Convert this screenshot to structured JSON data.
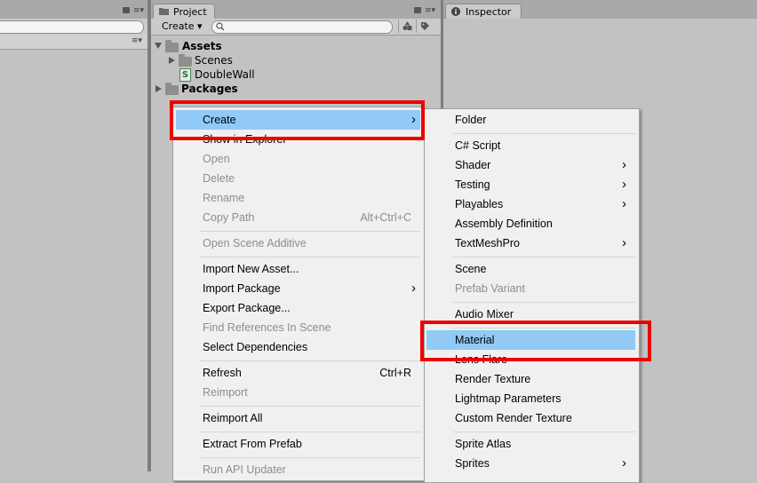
{
  "project_tab": {
    "label": "Project"
  },
  "inspector_tab": {
    "label": "Inspector"
  },
  "project_toolbar": {
    "create_label": "Create ▾"
  },
  "tree": {
    "assets": "Assets",
    "scenes": "Scenes",
    "doublewall": "DoubleWall",
    "packages": "Packages",
    "script_glyph": "S"
  },
  "context_menu": {
    "items": [
      {
        "label": "Create",
        "submenu": true,
        "highlighted": true
      },
      {
        "label": "Show in Explorer"
      },
      {
        "label": "Open",
        "disabled": true
      },
      {
        "label": "Delete",
        "disabled": true
      },
      {
        "label": "Rename",
        "disabled": true
      },
      {
        "label": "Copy Path",
        "shortcut": "Alt+Ctrl+C",
        "disabled": true
      },
      {
        "label": "Open Scene Additive",
        "disabled": true
      },
      {
        "label": "Import New Asset..."
      },
      {
        "label": "Import Package",
        "submenu": true
      },
      {
        "label": "Export Package..."
      },
      {
        "label": "Find References In Scene",
        "disabled": true
      },
      {
        "label": "Select Dependencies"
      },
      {
        "label": "Refresh",
        "shortcut": "Ctrl+R"
      },
      {
        "label": "Reimport",
        "disabled": true
      },
      {
        "label": "Reimport All"
      },
      {
        "label": "Extract From Prefab"
      },
      {
        "label": "Run API Updater",
        "disabled": true
      }
    ]
  },
  "create_submenu": {
    "items": [
      {
        "label": "Folder"
      },
      {
        "label": "C# Script"
      },
      {
        "label": "Shader",
        "submenu": true
      },
      {
        "label": "Testing",
        "submenu": true
      },
      {
        "label": "Playables",
        "submenu": true
      },
      {
        "label": "Assembly Definition"
      },
      {
        "label": "TextMeshPro",
        "submenu": true
      },
      {
        "label": "Scene"
      },
      {
        "label": "Prefab Variant",
        "disabled": true
      },
      {
        "label": "Audio Mixer"
      },
      {
        "label": "Material",
        "highlighted": true
      },
      {
        "label": "Lens Flare"
      },
      {
        "label": "Render Texture"
      },
      {
        "label": "Lightmap Parameters"
      },
      {
        "label": "Custom Render Texture"
      },
      {
        "label": "Sprite Atlas"
      },
      {
        "label": "Sprites",
        "submenu": true
      }
    ]
  },
  "colors": {
    "highlight": "#91c9f7",
    "annotation_red": "#ee0000",
    "disabled_text": "#8d8d8d"
  }
}
